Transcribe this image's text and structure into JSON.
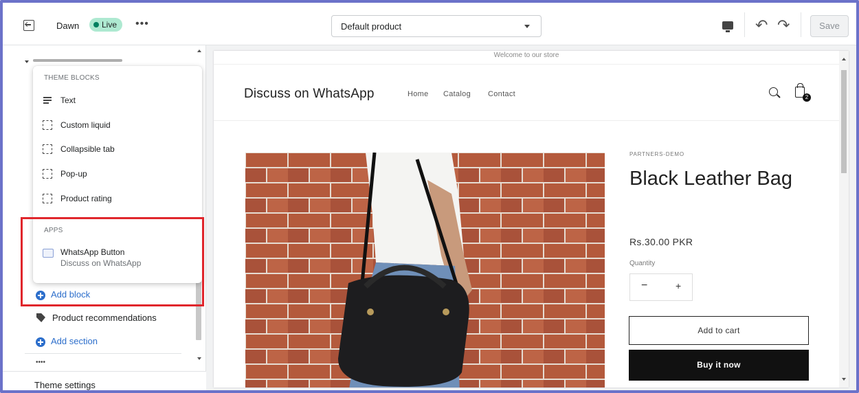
{
  "topbar": {
    "theme_name": "Dawn",
    "live_badge": "Live",
    "more": "•••",
    "template_select": "Default product",
    "undo": "↶",
    "redo": "↷",
    "save_label": "Save"
  },
  "sidebar": {
    "theme_blocks_heading": "THEME BLOCKS",
    "theme_blocks": [
      {
        "label": "Text",
        "icon": "text-icon"
      },
      {
        "label": "Custom liquid",
        "icon": "block-icon"
      },
      {
        "label": "Collapsible tab",
        "icon": "block-icon"
      },
      {
        "label": "Pop-up",
        "icon": "block-icon"
      },
      {
        "label": "Product rating",
        "icon": "block-icon"
      }
    ],
    "apps_heading": "APPS",
    "apps": [
      {
        "label": "WhatsApp Button",
        "sub": "Discuss on WhatsApp",
        "icon": "app-icon"
      }
    ],
    "add_block": "Add block",
    "product_recommendations": "Product recommendations",
    "add_section": "Add section",
    "small_dots": "••••",
    "theme_settings": "Theme settings"
  },
  "preview": {
    "announcement": "Welcome to our store",
    "store_name": "Discuss on WhatsApp",
    "nav": [
      "Home",
      "Catalog",
      "Contact"
    ],
    "cart_count": "2",
    "product": {
      "vendor": "PARTNERS-DEMO",
      "title": "Black Leather Bag",
      "price": "Rs.30.00 PKR",
      "quantity_label": "Quantity",
      "qty_minus": "−",
      "qty_plus": "+",
      "add_to_cart": "Add to cart",
      "buy_now": "Buy it now"
    }
  },
  "colors": {
    "accent": "#2c6ecb",
    "live_green": "#008060",
    "highlight_red": "#e0262c",
    "frame": "#6b72c9"
  }
}
